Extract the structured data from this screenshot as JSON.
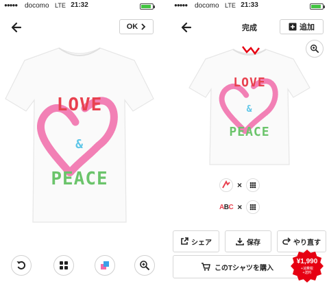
{
  "status": {
    "carrier": "docomo",
    "network": "LTE",
    "battery_level": 0.8,
    "signal": "●●●●●"
  },
  "left": {
    "time": "21:32",
    "ok_label": "OK",
    "design": {
      "line1": "LOVE",
      "ampersand": "&",
      "line2": "PEACE"
    }
  },
  "right": {
    "time": "21:33",
    "title": "完成",
    "add_label": "追加",
    "design": {
      "line1": "LOVE",
      "ampersand": "&",
      "line2": "PEACE"
    },
    "combo2_text": "ABC",
    "times_symbol": "×",
    "share_label": "シェア",
    "save_label": "保存",
    "redo_label": "やり直す",
    "buy_label": "このTシャツを購入",
    "price": "¥1,990",
    "price_tax": "+消費税",
    "price_ship": "+送料"
  },
  "colors": {
    "heart": "#f06aa8",
    "love": "#e8414f",
    "peace": "#6bc46b",
    "amp": "#5ec6e8",
    "badge": "#e60012"
  }
}
